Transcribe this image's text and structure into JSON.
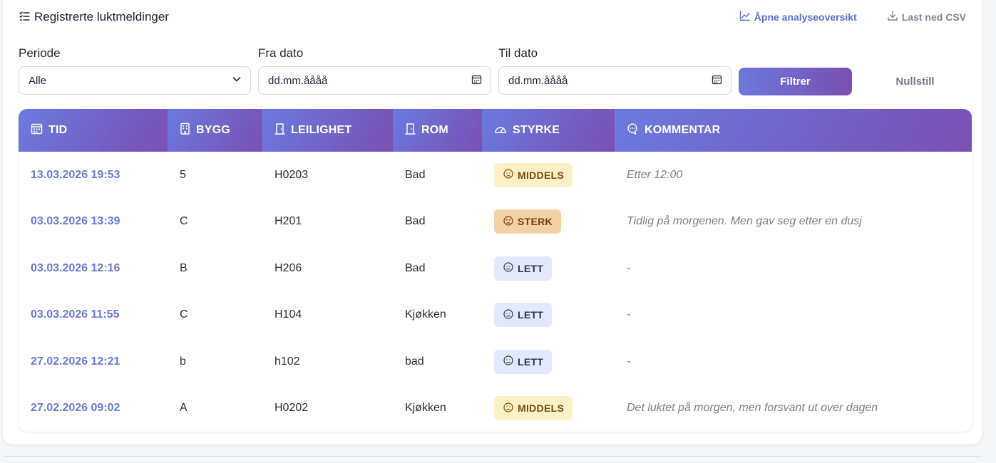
{
  "header": {
    "title": "Registrerte luktmeldinger",
    "analysis_link": "Åpne analyseoversikt",
    "csv_link": "Last ned CSV"
  },
  "filters": {
    "periode": {
      "label": "Periode",
      "value": "Alle"
    },
    "fra_dato": {
      "label": "Fra dato",
      "placeholder": "dd.mm.åååå"
    },
    "til_dato": {
      "label": "Til dato",
      "placeholder": "dd.mm.åååå"
    },
    "filter_button": "Filtrer",
    "reset_button": "Nullstill"
  },
  "table": {
    "columns": [
      {
        "label": "TID",
        "icon": "calendar-icon"
      },
      {
        "label": "BYGG",
        "icon": "building-icon"
      },
      {
        "label": "LEILIGHET",
        "icon": "door-icon"
      },
      {
        "label": "ROM",
        "icon": "door-icon"
      },
      {
        "label": "STYRKE",
        "icon": "gauge-icon"
      },
      {
        "label": "KOMMENTAR",
        "icon": "chat-icon"
      }
    ],
    "rows": [
      {
        "tid": "13.03.2026 19:53",
        "bygg": "5",
        "leilighet": "H0203",
        "rom": "Bad",
        "styrke": "MIDDELS",
        "kommentar": "Etter 12:00"
      },
      {
        "tid": "03.03.2026 13:39",
        "bygg": "C",
        "leilighet": "H201",
        "rom": "Bad",
        "styrke": "STERK",
        "kommentar": "Tidlig på morgenen. Men gav seg etter en dusj"
      },
      {
        "tid": "03.03.2026 12:16",
        "bygg": "B",
        "leilighet": "H206",
        "rom": "Bad",
        "styrke": "LETT",
        "kommentar": "-"
      },
      {
        "tid": "03.03.2026 11:55",
        "bygg": "C",
        "leilighet": "H104",
        "rom": "Kjøkken",
        "styrke": "LETT",
        "kommentar": "-"
      },
      {
        "tid": "27.02.2026 12:21",
        "bygg": "b",
        "leilighet": "h102",
        "rom": "bad",
        "styrke": "LETT",
        "kommentar": "-"
      },
      {
        "tid": "27.02.2026 09:02",
        "bygg": "A",
        "leilighet": "H0202",
        "rom": "Kjøkken",
        "styrke": "MIDDELS",
        "kommentar": "Det luktet på morgen, men forsvant ut over dagen"
      }
    ]
  },
  "badge_colors": {
    "MIDDELS": {
      "bg": "#fbf1c4",
      "fg": "#7a4a0e"
    },
    "STERK": {
      "bg": "#f1d2a6",
      "fg": "#7a3a12"
    },
    "LETT": {
      "bg": "#e2e9fb",
      "fg": "#2b3550"
    }
  },
  "colors": {
    "accent": "#5b6fd9",
    "header_gradient_start": "#6b7ae0",
    "header_gradient_end": "#7a50b2",
    "time_text": "#6d7ad6"
  }
}
